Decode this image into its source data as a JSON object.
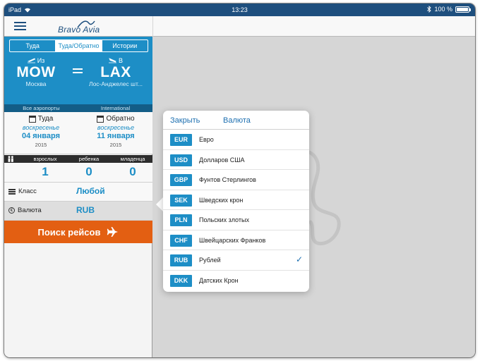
{
  "status_bar": {
    "device": "iPad",
    "time": "13:23",
    "battery": "100 %",
    "battery_level": 1.0
  },
  "nav": {
    "logo_text": "Bravo Avia"
  },
  "trip_type": {
    "tabs": [
      "Туда",
      "Туда/Обратно",
      "Истории"
    ],
    "active_index": 1
  },
  "route": {
    "from": {
      "direction_label": "Из",
      "code": "MOW",
      "city": "Москва",
      "airports": "Все аэропорты"
    },
    "swap_symbol": "=",
    "to": {
      "direction_label": "В",
      "code": "LAX",
      "city": "Лос-Анджелес шт...",
      "airports": "International"
    }
  },
  "dates": {
    "departure": {
      "label": "Туда",
      "weekday": "воскресенье",
      "date": "04 января",
      "year": "2015"
    },
    "return": {
      "label": "Обратно",
      "weekday": "воскресенье",
      "date": "11 января",
      "year": "2015"
    }
  },
  "passengers": {
    "headers": [
      "взрослых",
      "ребенка",
      "младенца"
    ],
    "counts": [
      "1",
      "0",
      "0"
    ]
  },
  "class_row": {
    "label": "Класс",
    "value": "Любой"
  },
  "currency_row": {
    "label": "Валюта",
    "value": "RUB"
  },
  "search_button": {
    "label": "Поиск рейсов"
  },
  "popover": {
    "close_label": "Закрыть",
    "title": "Валюта",
    "items": [
      {
        "code": "EUR",
        "name": "Евро",
        "selected": false
      },
      {
        "code": "USD",
        "name": "Долларов США",
        "selected": false
      },
      {
        "code": "GBP",
        "name": "Фунтов Стерлингов",
        "selected": false
      },
      {
        "code": "SEK",
        "name": "Шведских крон",
        "selected": false
      },
      {
        "code": "PLN",
        "name": "Польских злотых",
        "selected": false
      },
      {
        "code": "CHF",
        "name": "Швейцарских Франков",
        "selected": false
      },
      {
        "code": "RUB",
        "name": "Рублей",
        "selected": true
      },
      {
        "code": "DKK",
        "name": "Датских Крон",
        "selected": false
      }
    ]
  },
  "colors": {
    "accent": "#1d8ec6",
    "nav_blue": "#1e4f7e",
    "search_orange": "#e35f12"
  }
}
